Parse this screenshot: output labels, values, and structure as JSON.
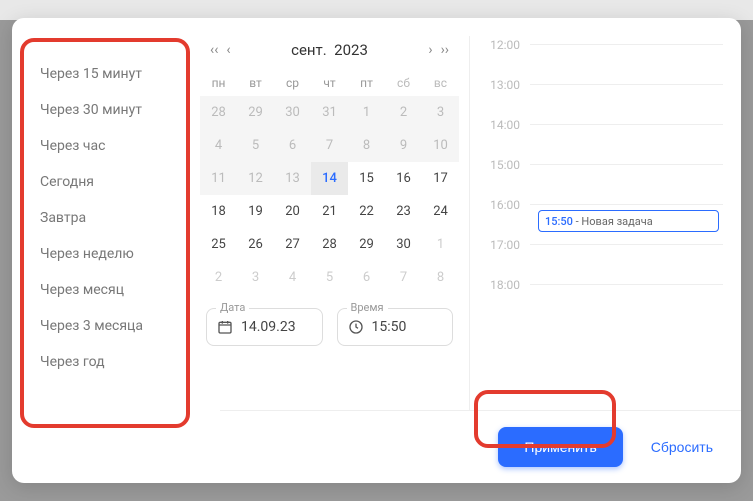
{
  "presets": {
    "items": [
      "Через 15 минут",
      "Через 30 минут",
      "Через час",
      "Сегодня",
      "Завтра",
      "Через неделю",
      "Через месяц",
      "Через 3 месяца",
      "Через год"
    ]
  },
  "calendar": {
    "month_label": "сент.",
    "year_label": "2023",
    "dow": [
      "пн",
      "вт",
      "ср",
      "чт",
      "пт",
      "сб",
      "вс"
    ],
    "weeks": [
      [
        {
          "d": "28",
          "m": true,
          "g": true
        },
        {
          "d": "29",
          "m": true,
          "g": true
        },
        {
          "d": "30",
          "m": true,
          "g": true
        },
        {
          "d": "31",
          "m": true,
          "g": true
        },
        {
          "d": "1",
          "g": true
        },
        {
          "d": "2",
          "g": true
        },
        {
          "d": "3",
          "g": true
        }
      ],
      [
        {
          "d": "4",
          "g": true
        },
        {
          "d": "5",
          "g": true
        },
        {
          "d": "6",
          "g": true
        },
        {
          "d": "7",
          "g": true
        },
        {
          "d": "8",
          "g": true
        },
        {
          "d": "9",
          "g": true
        },
        {
          "d": "10",
          "g": true
        }
      ],
      [
        {
          "d": "11",
          "g": true
        },
        {
          "d": "12",
          "g": true
        },
        {
          "d": "13",
          "g": true
        },
        {
          "d": "14",
          "sel": true
        },
        {
          "d": "15"
        },
        {
          "d": "16"
        },
        {
          "d": "17"
        }
      ],
      [
        {
          "d": "18"
        },
        {
          "d": "19"
        },
        {
          "d": "20"
        },
        {
          "d": "21"
        },
        {
          "d": "22"
        },
        {
          "d": "23"
        },
        {
          "d": "24"
        }
      ],
      [
        {
          "d": "25"
        },
        {
          "d": "26"
        },
        {
          "d": "27"
        },
        {
          "d": "28"
        },
        {
          "d": "29"
        },
        {
          "d": "30"
        },
        {
          "d": "1",
          "m": true
        }
      ],
      [
        {
          "d": "2",
          "m": true
        },
        {
          "d": "3",
          "m": true
        },
        {
          "d": "4",
          "m": true
        },
        {
          "d": "5",
          "m": true
        },
        {
          "d": "6",
          "m": true
        },
        {
          "d": "7",
          "m": true
        },
        {
          "d": "8",
          "m": true
        }
      ]
    ]
  },
  "fields": {
    "date": {
      "label": "Дата",
      "value": "14.09.23"
    },
    "time": {
      "label": "Время",
      "value": "15:50"
    }
  },
  "timeline": {
    "hours": [
      "12:00",
      "13:00",
      "14:00",
      "15:00",
      "16:00",
      "17:00",
      "18:00"
    ],
    "event": {
      "time": "15:50",
      "title": "Новая задача"
    }
  },
  "footer": {
    "apply": "Применить",
    "reset": "Сбросить"
  },
  "nav": {
    "first": "‹‹",
    "prev": "‹",
    "next": "›",
    "last": "››"
  }
}
